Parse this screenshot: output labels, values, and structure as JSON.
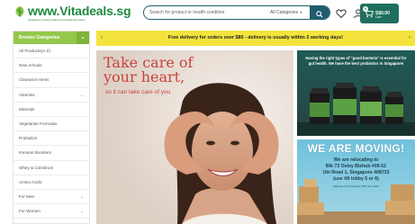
{
  "header": {
    "logo_text": "www.Vitadeals.sg",
    "logo_tagline": "Singapore's online health and supplement store",
    "search_placeholder": "Search for product or health condition",
    "category_select": "All Categories",
    "cart_count": "0",
    "cart_total": "S$0.00",
    "cart_label": "Cart"
  },
  "announcement": {
    "message": "Free delivery for orders over $80 - delivery is usually within 2 working days!"
  },
  "sidebar": {
    "heading": "Browse Categories",
    "items": [
      {
        "label": "All Products(A-Z)",
        "has_arrow": false
      },
      {
        "label": "New Arrivals",
        "has_arrow": false
      },
      {
        "label": "Clearance Items",
        "has_arrow": false
      },
      {
        "label": "Vitamins",
        "has_arrow": true
      },
      {
        "label": "Minerals",
        "has_arrow": false
      },
      {
        "label": "Vegetarian Formulas",
        "has_arrow": false
      },
      {
        "label": "Probiotics",
        "has_arrow": false
      },
      {
        "label": "Immune Boosters",
        "has_arrow": false
      },
      {
        "label": "Whey & Colostrum",
        "has_arrow": false
      },
      {
        "label": "Amino Acids",
        "has_arrow": false
      },
      {
        "label": "For Men",
        "has_arrow": true
      },
      {
        "label": "For Women",
        "has_arrow": true
      }
    ]
  },
  "hero": {
    "title_line1": "Take care of",
    "title_line2": "your heart,",
    "subtitle": "so it can take care of you"
  },
  "promo": {
    "text": "Having the right types of \"good bacteria\" is essential for gut health. We have the best probiotics in Singapore!"
  },
  "moving": {
    "title": "WE ARE MOVING!",
    "line1": "We are relocating to",
    "line2": "Blk 73 Oxley Bizhub #09-51",
    "line3": "Ubi Road 1, Singapore 408733",
    "line4": "(use lift lobby 5 or 6)",
    "note": "Effective from Monday, 20th Nov 2023"
  },
  "colors": {
    "brand_green": "#1d8a3e",
    "sidebar_header": "#94c84b",
    "announcement_bg": "#f4e33c",
    "search_accent": "#1f5d6e",
    "cart_bg": "#1f6f5c",
    "hero_text": "#c9423b"
  }
}
